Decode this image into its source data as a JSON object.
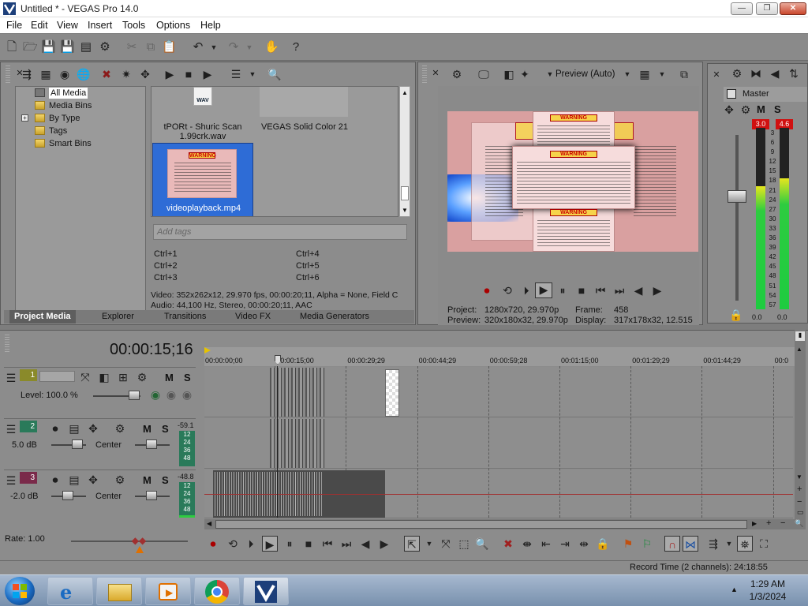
{
  "app": {
    "title": "Untitled * - VEGAS Pro 14.0",
    "window_controls": {
      "minimize": "—",
      "maximize": "❐",
      "close": "✕"
    }
  },
  "menu": [
    "File",
    "Edit",
    "View",
    "Insert",
    "Tools",
    "Options",
    "Help"
  ],
  "project_media": {
    "tree": [
      "All Media",
      "Media Bins",
      "By Type",
      "Tags",
      "Smart Bins"
    ],
    "expand_glyph": "+",
    "items": [
      {
        "name": "tPORt - Shuric Scan 1.99crk.wav",
        "badge": "WAV"
      },
      {
        "name": "VEGAS Solid Color 21"
      },
      {
        "name": "videoplayback.mp4",
        "selected": true
      }
    ],
    "tags_placeholder": "Add tags",
    "shortcuts": [
      "Ctrl+1",
      "Ctrl+4",
      "Ctrl+2",
      "Ctrl+5",
      "Ctrl+3",
      "Ctrl+6"
    ],
    "video_info": "Video: 352x262x12, 29.970 fps, 00:00:20;11, Alpha = None, Field C",
    "audio_info": "Audio: 44,100 Hz, Stereo, 00:00:20;11, AAC",
    "tabs": [
      "Project Media",
      "Explorer",
      "Transitions",
      "Video FX",
      "Media Generators"
    ]
  },
  "preview": {
    "mode_label": "Preview (Auto)",
    "warning_text": "WARNING",
    "project_label": "Project:",
    "project_value": "1280x720, 29.970p",
    "preview_label": "Preview:",
    "preview_value": "320x180x32, 29.970p",
    "frame_label": "Frame:",
    "frame_value": "458",
    "display_label": "Display:",
    "display_value": "317x178x32, 12.515"
  },
  "mixer": {
    "master_label": "Master",
    "mute": "M",
    "solo": "S",
    "peak_left": "3.0",
    "peak_right": "4.6",
    "scale": [
      "3",
      "6",
      "9",
      "12",
      "15",
      "18",
      "21",
      "24",
      "27",
      "30",
      "33",
      "36",
      "39",
      "42",
      "45",
      "48",
      "51",
      "54",
      "57"
    ],
    "bottom_left": "0.0",
    "bottom_right": "0.0",
    "level_left": 0.68,
    "level_right": 0.72
  },
  "timeline": {
    "timecode": "00:00:15;16",
    "ruler": [
      "00:00:00;00",
      "00:00:15;00",
      "00:00:29;29",
      "00:00:44;29",
      "00:00:59;28",
      "00:01:15;00",
      "00:01:29;29",
      "00:01:44;29",
      "00:0"
    ],
    "tracks": [
      {
        "num": "1",
        "type": "video",
        "level": "Level: 100.0 %",
        "color": "#8a8a2a"
      },
      {
        "num": "2",
        "type": "audio",
        "vol": "5.0 dB",
        "pan": "Center",
        "meter_top": "-59.1",
        "color": "#2a7a5a"
      },
      {
        "num": "3",
        "type": "audio",
        "vol": "-2.0 dB",
        "pan": "Center",
        "meter_top": "-48.8",
        "color": "#7a2a4a"
      }
    ],
    "meter_scale": [
      "12",
      "24",
      "36",
      "48"
    ],
    "rate": "Rate: 1.00",
    "status": "Record Time (2 channels): 24:18:55"
  },
  "taskbar": {
    "time": "1:29 AM",
    "date": "1/3/2024"
  }
}
